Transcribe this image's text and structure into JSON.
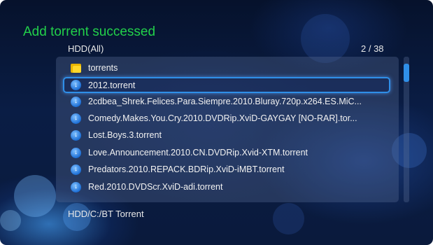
{
  "title": "Add torrent successed",
  "header": {
    "source": "HDD(All)",
    "counter": "2 / 38"
  },
  "list": {
    "items": [
      {
        "label": "torrents",
        "type": "folder",
        "selected": false
      },
      {
        "label": "2012.torrent",
        "type": "torrent",
        "selected": true
      },
      {
        "label": "2cdbea_Shrek.Felices.Para.Siempre.2010.Bluray.720p.x264.ES.MiC...",
        "type": "torrent",
        "selected": false
      },
      {
        "label": "Comedy.Makes.You.Cry.2010.DVDRip.XviD-GAYGAY [NO-RAR].tor...",
        "type": "torrent",
        "selected": false
      },
      {
        "label": "Lost.Boys.3.torrent",
        "type": "torrent",
        "selected": false
      },
      {
        "label": "Love.Announcement.2010.CN.DVDRip.Xvid-XTM.torrent",
        "type": "torrent",
        "selected": false
      },
      {
        "label": "Predators.2010.REPACK.BDRip.XviD-iMBT.torrent",
        "type": "torrent",
        "selected": false
      },
      {
        "label": "Red.2010.DVDScr.XviD-adi.torrent",
        "type": "torrent",
        "selected": false
      }
    ]
  },
  "footer": {
    "path": "HDD/C:/BT Torrent"
  },
  "colors": {
    "title": "#22d04a",
    "accent": "#2f8fe8",
    "folder": "#ffd72a"
  },
  "icons": {
    "folder": "folder-icon",
    "torrent": "torrent-icon"
  },
  "icon_glyph": "↓"
}
